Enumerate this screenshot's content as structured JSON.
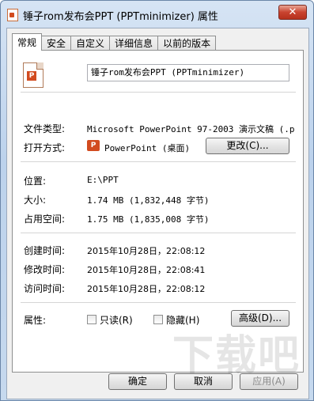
{
  "window": {
    "title": "锤子rom发布会PPT (PPTminimizer) 属性",
    "close_glyph": "✕"
  },
  "tabs": [
    {
      "label": "常规",
      "active": true
    },
    {
      "label": "安全",
      "active": false
    },
    {
      "label": "自定义",
      "active": false
    },
    {
      "label": "详细信息",
      "active": false
    },
    {
      "label": "以前的版本",
      "active": false
    }
  ],
  "general": {
    "file_name": "锤子rom发布会PPT (PPTminimizer)",
    "file_type_label": "文件类型:",
    "file_type_value": "Microsoft PowerPoint 97-2003 演示文稿 (.p",
    "open_with_label": "打开方式:",
    "open_with_value": "PowerPoint (桌面)",
    "change_button": "更改(C)...",
    "location_label": "位置:",
    "location_value": "E:\\PPT",
    "size_label": "大小:",
    "size_value": "1.74 MB (1,832,448 字节)",
    "size_on_disk_label": "占用空间:",
    "size_on_disk_value": "1.75 MB (1,835,008 字节)",
    "created_label": "创建时间:",
    "created_value": "2015年10月28日，22:08:12",
    "modified_label": "修改时间:",
    "modified_value": "2015年10月28日，22:08:41",
    "accessed_label": "访问时间:",
    "accessed_value": "2015年10月28日，22:08:12",
    "attributes_label": "属性:",
    "readonly_label": "只读(R)",
    "readonly_checked": false,
    "hidden_label": "隐藏(H)",
    "hidden_checked": false,
    "advanced_button": "高级(D)..."
  },
  "footer": {
    "ok_button": "确定",
    "cancel_button": "取消",
    "apply_button": "应用(A)"
  },
  "watermark_text": "下载吧"
}
